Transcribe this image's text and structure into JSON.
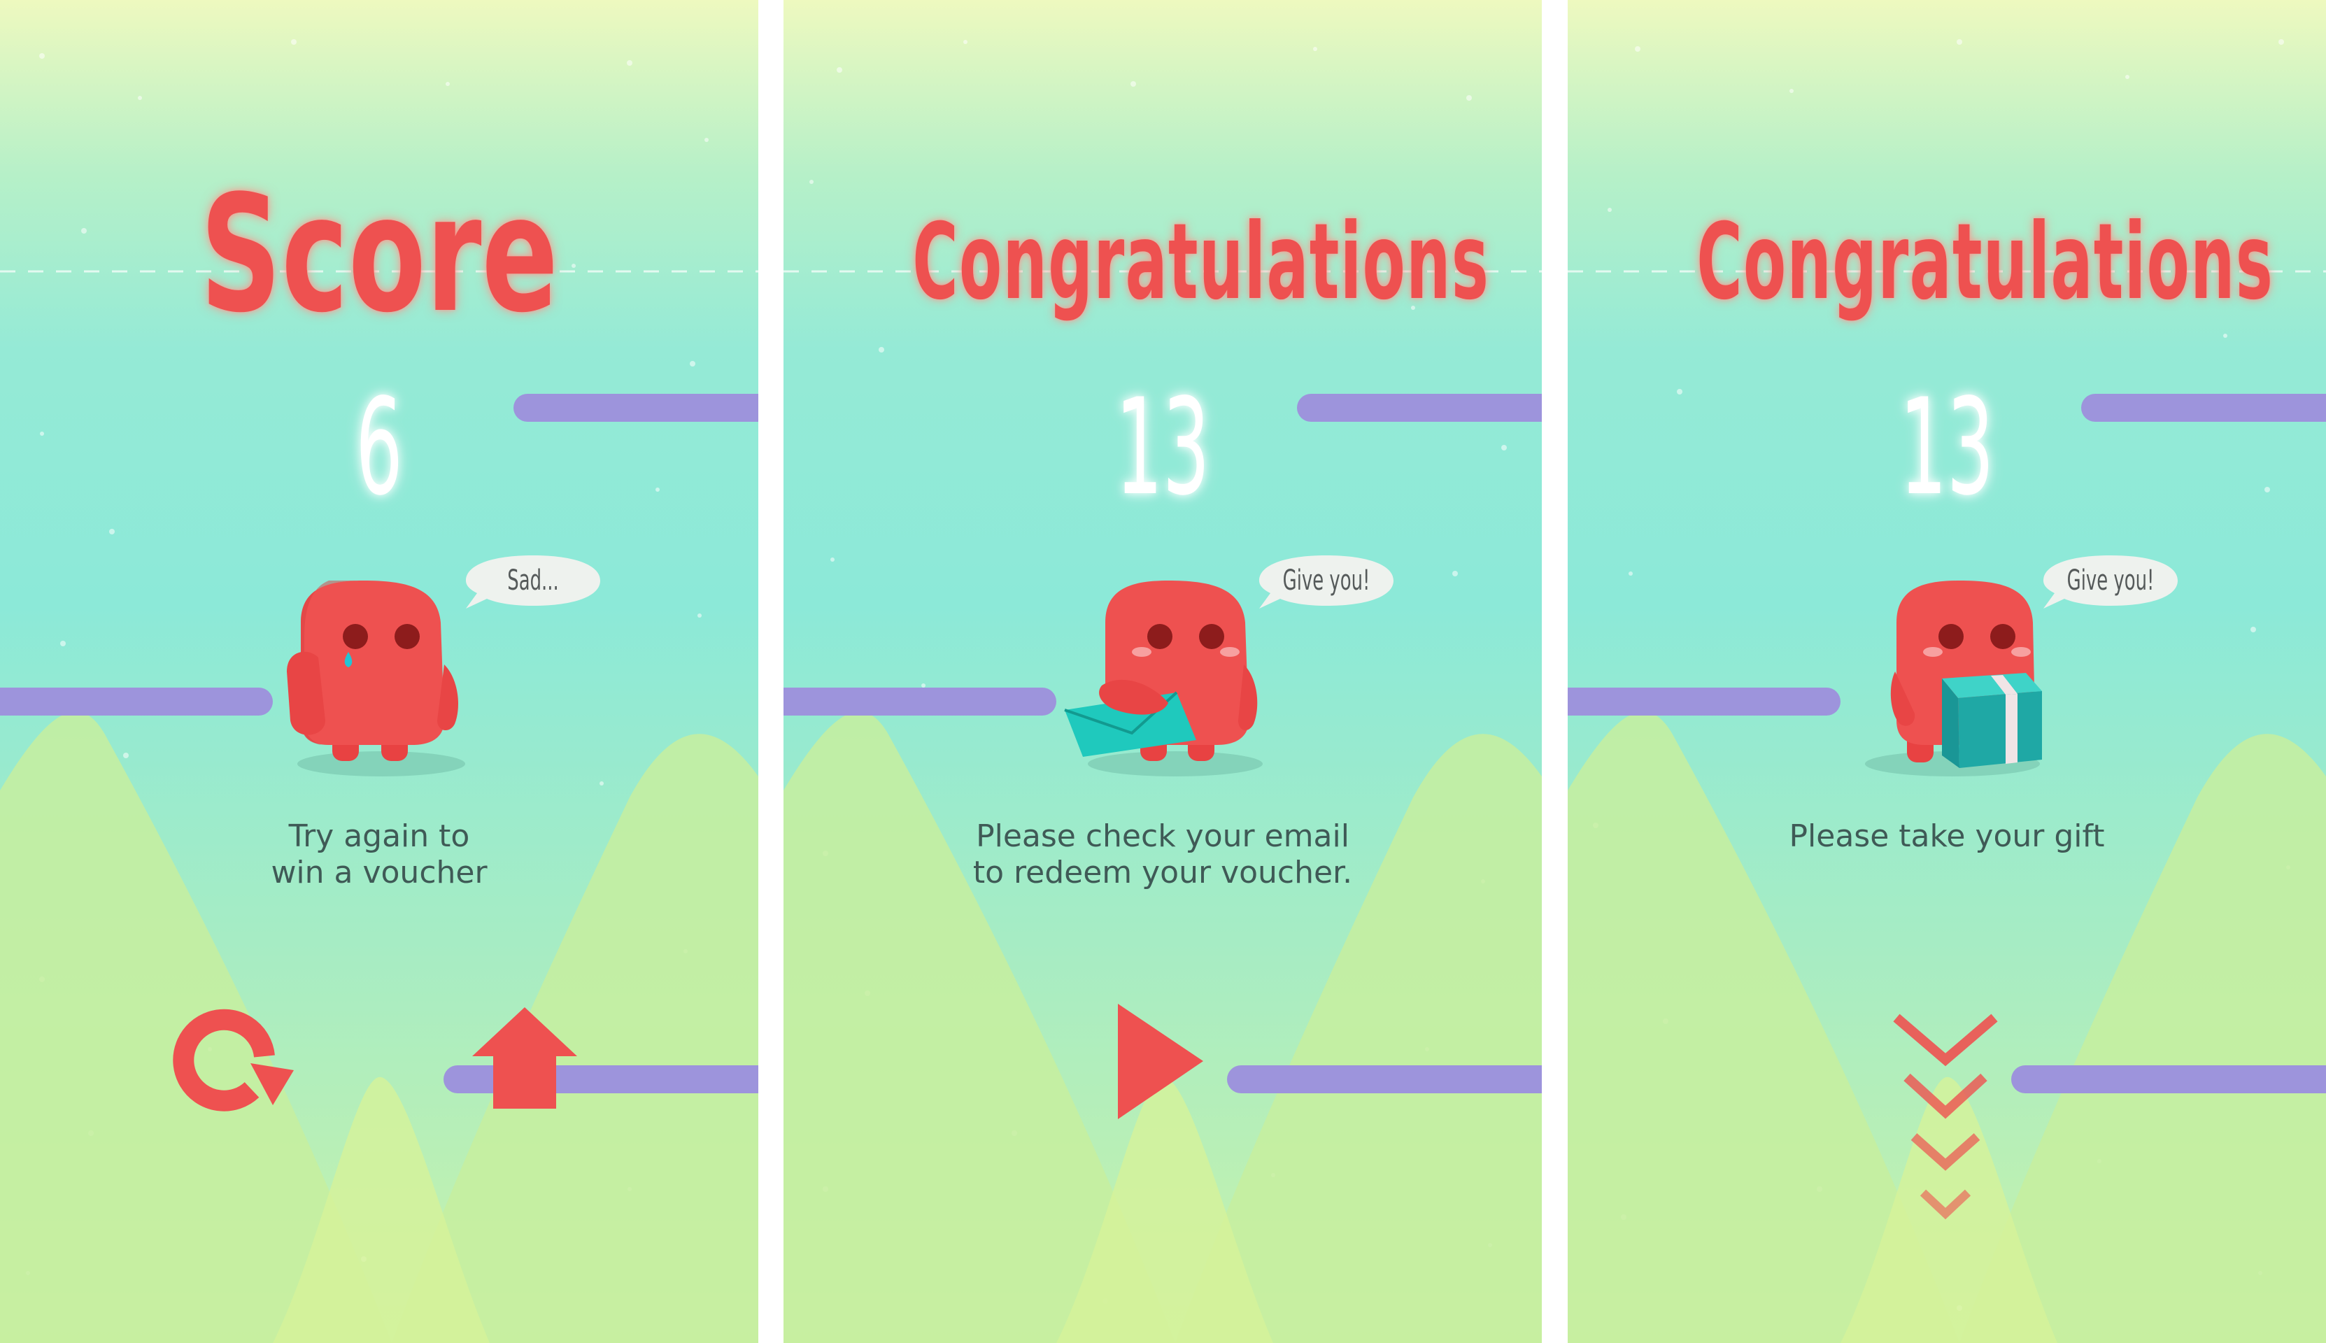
{
  "screens": [
    {
      "title": "Score",
      "score": "6",
      "speech": "Sad...",
      "message_lines": [
        "Try again to",
        "win a voucher"
      ],
      "buttons": [
        "replay-icon",
        "home-icon"
      ]
    },
    {
      "title": "Congratulations",
      "score": "13",
      "speech": "Give you!",
      "message_lines": [
        "Please check your email",
        "to redeem your voucher."
      ],
      "buttons": [
        "play-icon"
      ]
    },
    {
      "title": "Congratulations",
      "score": "13",
      "speech": "Give you!",
      "message_lines": [
        "Please take your gift"
      ],
      "buttons": [
        "chevron-down-icon"
      ]
    }
  ],
  "colors": {
    "accent_red": "#ee5150",
    "platform_purple": "#9d94dc",
    "mountain_green": "#c4ee9c",
    "envelope_teal": "#1fc9bd",
    "gift_teal": "#1fa8a5"
  }
}
